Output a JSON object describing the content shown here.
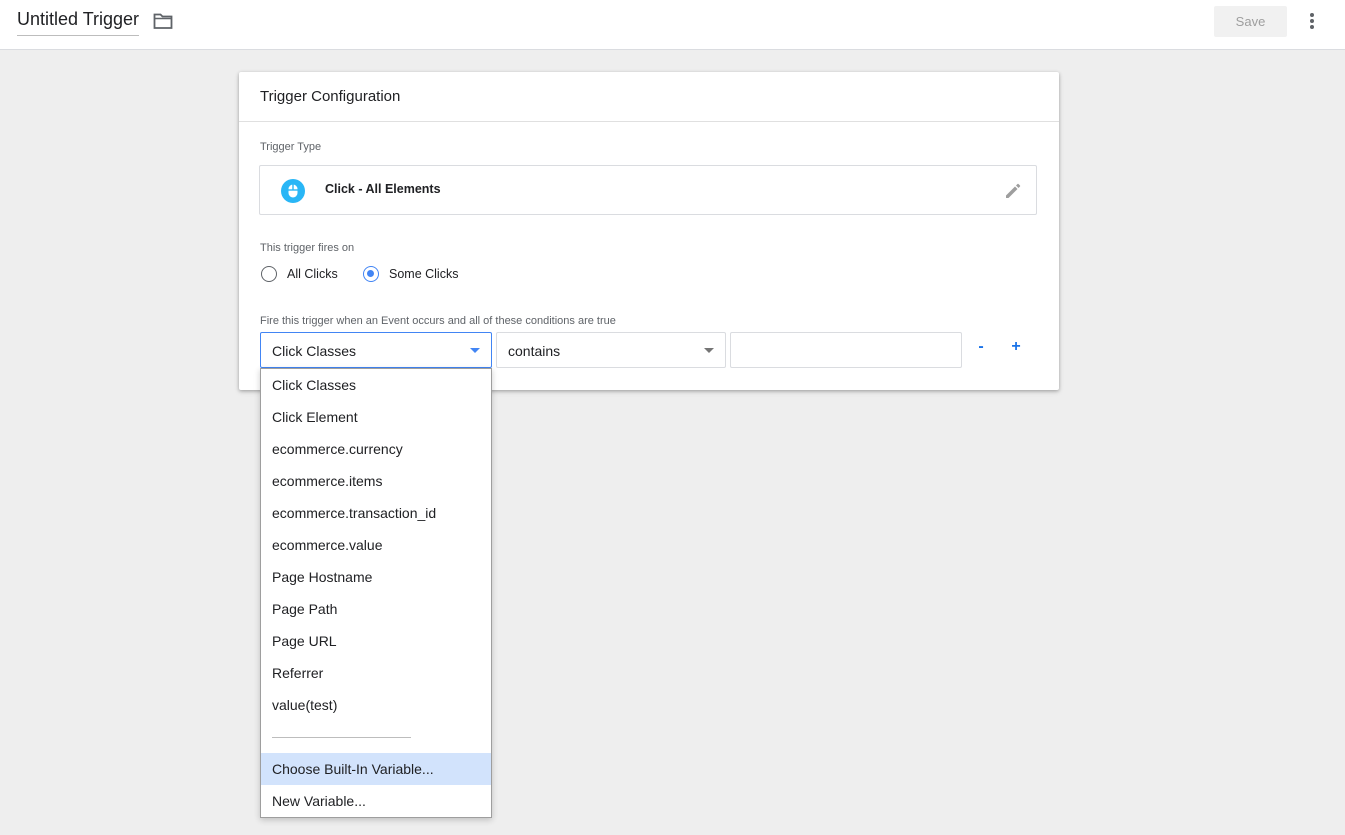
{
  "topbar": {
    "title": "Untitled Trigger",
    "save_label": "Save",
    "icons": [
      "folder-icon",
      "more-vert-icon"
    ]
  },
  "card": {
    "header": "Trigger Configuration",
    "trigger_type_label": "Trigger Type",
    "trigger_type_name": "Click - All Elements",
    "fires_on_label": "This trigger fires on",
    "radio_all": "All Clicks",
    "radio_some": "Some Clicks",
    "selected_radio": "Some Clicks",
    "conditions_label": "Fire this trigger when an Event occurs and all of these conditions are true",
    "condition": {
      "variable": "Click Classes",
      "operator": "contains",
      "value": ""
    },
    "remove_label": "-",
    "add_label": "+"
  },
  "dropdown": {
    "options": [
      "Click Classes",
      "Click Element",
      "ecommerce.currency",
      "ecommerce.items",
      "ecommerce.transaction_id",
      "ecommerce.value",
      "Page Hostname",
      "Page Path",
      "Page URL",
      "Referrer",
      "value(test)"
    ],
    "choose_builtin": "Choose Built-In Variable...",
    "new_variable": "New Variable..."
  },
  "colors": {
    "accent": "#4285f4",
    "highlight": "#d2e3fc",
    "mouse_icon_bg": "#29b6f6"
  }
}
